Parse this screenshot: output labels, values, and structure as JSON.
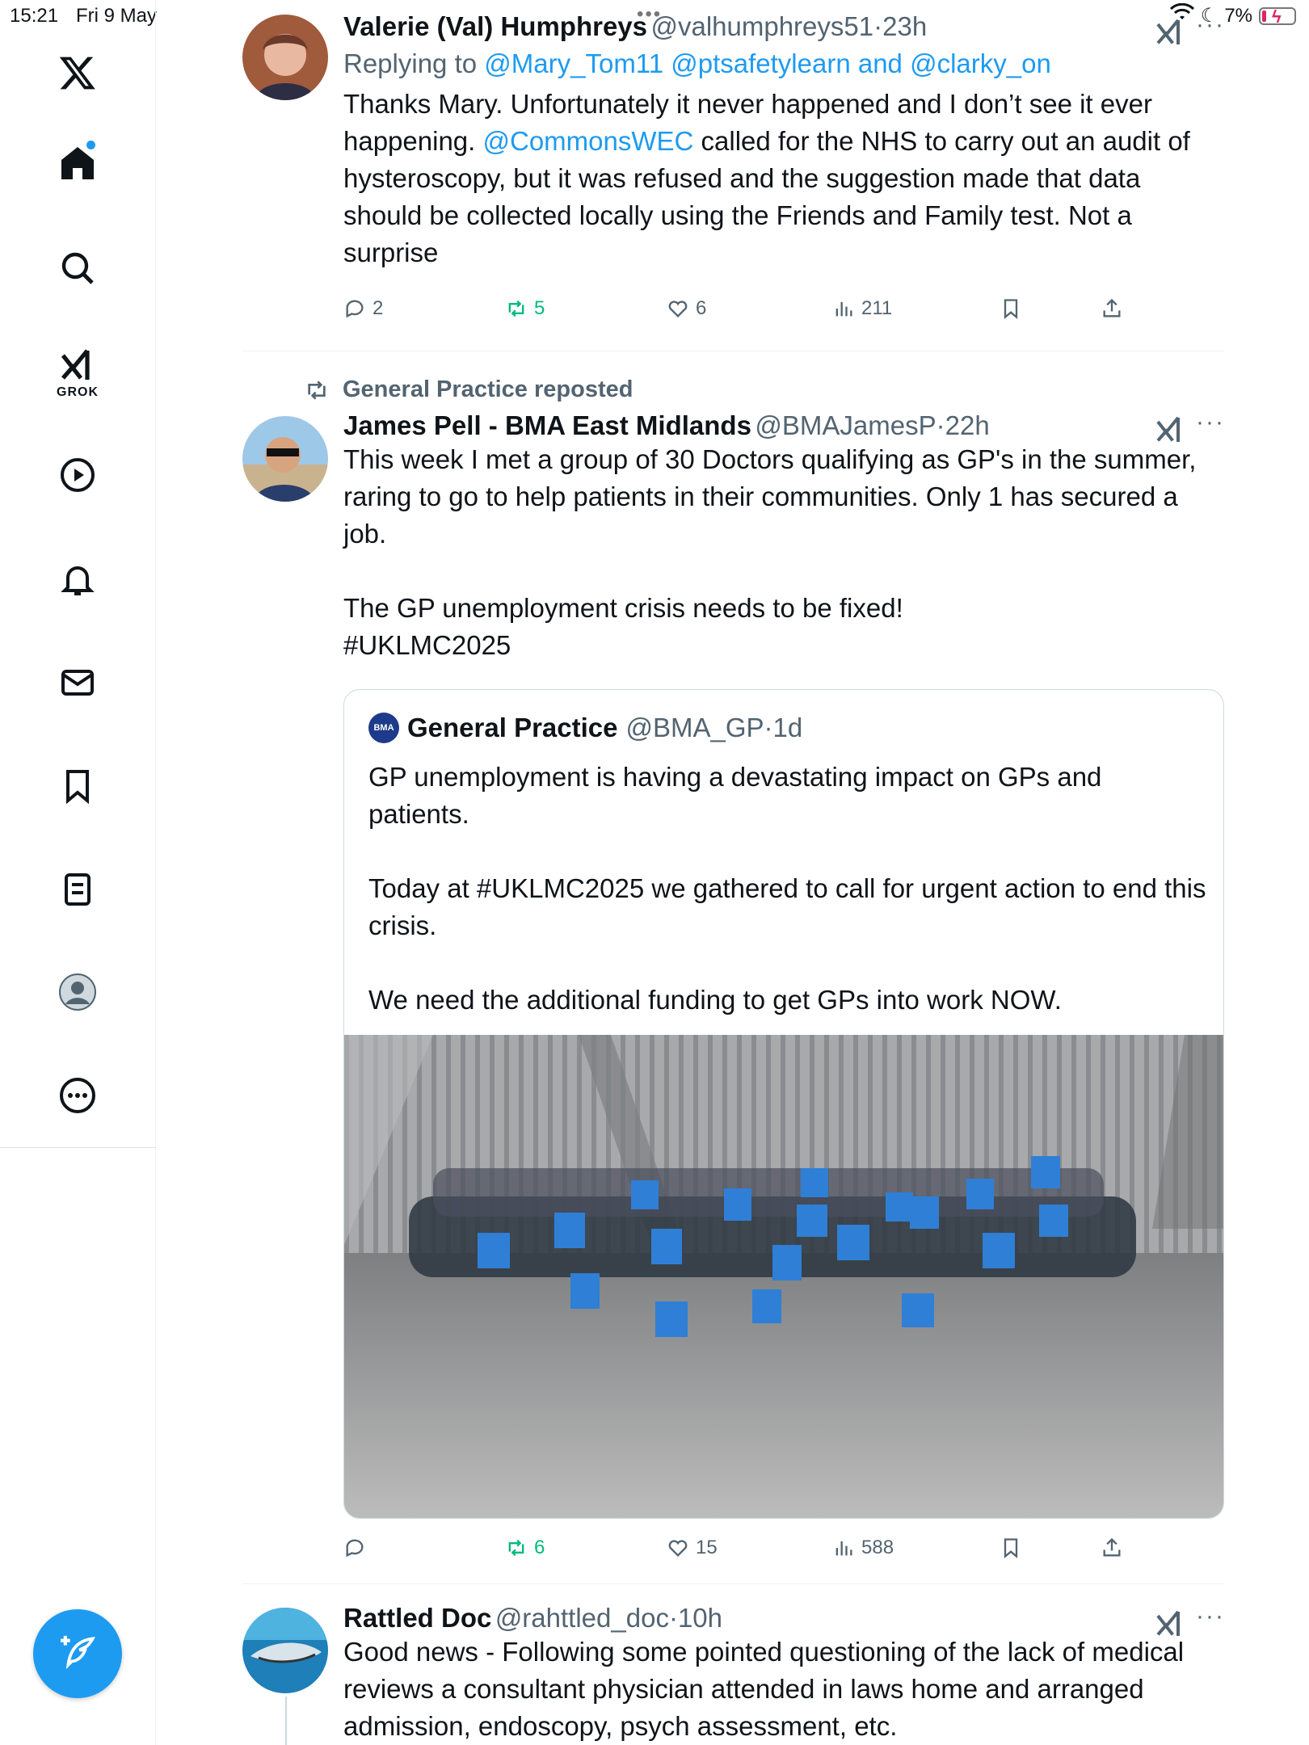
{
  "status_bar": {
    "time": "15:21",
    "date": "Fri 9 May",
    "battery": "7%"
  },
  "sidebar": {
    "items": [
      {
        "label": "Home",
        "icon": "home-icon"
      },
      {
        "label": "Search",
        "icon": "search-icon"
      },
      {
        "label": "GROK",
        "icon": "grok-icon"
      },
      {
        "label": "Video",
        "icon": "play-icon"
      },
      {
        "label": "Notifications",
        "icon": "bell-icon"
      },
      {
        "label": "Messages",
        "icon": "mail-icon"
      },
      {
        "label": "Bookmarks",
        "icon": "bookmark-icon"
      },
      {
        "label": "Lists",
        "icon": "list-icon"
      },
      {
        "label": "Profile",
        "icon": "profile-icon"
      },
      {
        "label": "More",
        "icon": "more-icon"
      }
    ],
    "grok_label": "GROK"
  },
  "tweets": [
    {
      "name": "Valerie (Val) Humphreys",
      "handle": "@valhumphreys51",
      "time": "23h",
      "replying_prefix": "Replying to",
      "replying_to": "@Mary_Tom11 @ptsafetylearn and @clarky_on",
      "text_part1": "Thanks Mary. Unfortunately it never happened and I don’t see it ever happening.",
      "text_link": "@CommonsWEC",
      "text_part2": "called for the NHS to carry out an audit of hysteroscopy, but it was refused and the suggestion made that data should be collected locally using the Friends and Family test. Not a surprise",
      "replies": "2",
      "reposts": "5",
      "likes": "6",
      "views": "211"
    },
    {
      "repost_label": "General Practice reposted",
      "name": "James Pell - BMA East Midlands",
      "handle": "@BMAJamesP",
      "time": "22h",
      "text": "This week I met a group of 30 Doctors qualifying as GP's in the summer, raring to go to help patients in their communities. Only 1 has secured a job.\n\nThe GP unemployment crisis needs to be fixed!",
      "hashtag": "#UKLMC2025",
      "quote": {
        "logo": "BMA",
        "name": "General Practice",
        "handle": "@BMA_GP",
        "time": "1d",
        "text": "GP unemployment is having a devastating impact on GPs and patients.\n\nToday at #UKLMC2025 we gathered to call for urgent action to end this crisis.\n\nWe need the additional funding to get GPs into work NOW."
      },
      "replies": "",
      "reposts": "6",
      "likes": "15",
      "views": "588"
    },
    {
      "name": "Rattled Doc",
      "handle": "@rahttled_doc",
      "time": "10h",
      "text": "Good news - Following some pointed questioning of the lack of medical reviews a consultant physician attended in laws home and arranged admission, endoscopy, psych assessment, etc."
    }
  ],
  "colors": {
    "accent": "#1d9bf0",
    "repost_green": "#00ba7c",
    "secondary_text": "#536471"
  }
}
